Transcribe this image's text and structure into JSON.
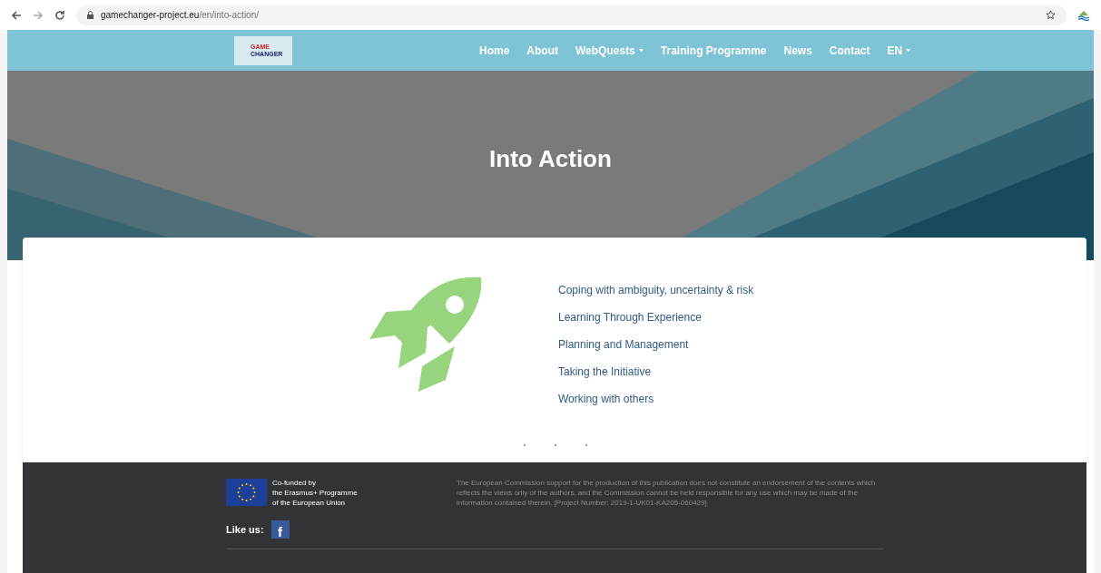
{
  "browser": {
    "url_host": "gamechanger-project.eu",
    "url_path": "/en/into-action/"
  },
  "nav": {
    "logo_lines": [
      "GAME",
      "CHANGER"
    ],
    "items": [
      {
        "label": "Home",
        "dropdown": false
      },
      {
        "label": "About",
        "dropdown": false
      },
      {
        "label": "WebQuests",
        "dropdown": true
      },
      {
        "label": "Training Programme",
        "dropdown": false
      },
      {
        "label": "News",
        "dropdown": false
      },
      {
        "label": "Contact",
        "dropdown": false
      },
      {
        "label": "EN",
        "dropdown": true
      }
    ]
  },
  "hero": {
    "title": "Into Action"
  },
  "links": [
    "Coping with ambiguity, uncertainty & risk",
    "Learning Through Experience",
    "Planning and Management",
    "Taking the Initiative",
    "Working with others"
  ],
  "footer": {
    "eu_lines": [
      "Co-funded by",
      "the Erasmus+ Programme",
      "of the European Union"
    ],
    "disclaimer": "The European Commission support for the production of this publication does not constitute an endorsement of the contents which reflects the views only of the authors, and the Commission cannot be held responsible for any use which may be made of the information contained therein. [Project Number: 2019-1-UK01-KA205-060429]",
    "like_label": "Like us:",
    "facebook_letter": "f"
  }
}
